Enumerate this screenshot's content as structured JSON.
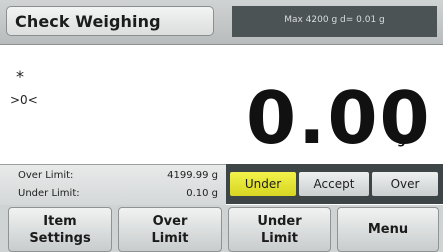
{
  "header": {
    "title": "Check Weighing",
    "capacity": "Max 4200 g   d= 0.01 g"
  },
  "indicators": {
    "stable": "*",
    "center_zero": ">0<"
  },
  "reading": {
    "value": "0.00",
    "unit": "g"
  },
  "limits": {
    "over_label": "Over Limit:",
    "over_value": "4199.99 g",
    "under_label": "Under Limit:",
    "under_value": "0.10 g"
  },
  "status": {
    "under": "Under",
    "accept": "Accept",
    "over": "Over",
    "active": "Under",
    "active_color": "#e6e532"
  },
  "buttons": {
    "item_settings_line1": "Item",
    "item_settings_line2": "Settings",
    "over_limit_line1": "Over",
    "over_limit_line2": "Limit",
    "under_limit_line1": "Under",
    "under_limit_line2": "Limit",
    "menu": "Menu"
  }
}
